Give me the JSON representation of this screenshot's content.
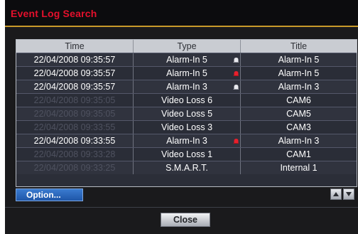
{
  "window": {
    "title": "Event Log Search"
  },
  "table": {
    "headers": {
      "time": "Time",
      "type": "Type",
      "title": "Title"
    },
    "rows": [
      {
        "time": "22/04/2008  09:35:57",
        "type": "Alarm-In 5",
        "title": "Alarm-In 5",
        "icon": "bell-white-icon",
        "dim_time": false
      },
      {
        "time": "22/04/2008  09:35:57",
        "type": "Alarm-In 5",
        "title": "Alarm-In 5",
        "icon": "bell-red-icon",
        "dim_time": false
      },
      {
        "time": "22/04/2008  09:35:57",
        "type": "Alarm-In 3",
        "title": "Alarm-In 3",
        "icon": "bell-white-icon",
        "dim_time": false
      },
      {
        "time": "22/04/2008  09:35:05",
        "type": "Video Loss 6",
        "title": "CAM6",
        "icon": "",
        "dim_time": true
      },
      {
        "time": "22/04/2008  09:35:05",
        "type": "Video Loss 5",
        "title": "CAM5",
        "icon": "",
        "dim_time": true
      },
      {
        "time": "22/04/2008  09:33:55",
        "type": "Video Loss 3",
        "title": "CAM3",
        "icon": "",
        "dim_time": true
      },
      {
        "time": "22/04/2008  09:33:55",
        "type": "Alarm-In 3",
        "title": "Alarm-In 3",
        "icon": "bell-red-icon",
        "dim_time": false
      },
      {
        "time": "22/04/2008  09:33:28",
        "type": "Video Loss 1",
        "title": "CAM1",
        "icon": "",
        "dim_time": true
      },
      {
        "time": "22/04/2008  09:33:25",
        "type": "S.M.A.R.T.",
        "title": "Internal 1",
        "icon": "",
        "dim_time": true
      }
    ]
  },
  "buttons": {
    "option": "Option...",
    "close": "Close",
    "scroll_up_icon": "triangle-up-icon",
    "scroll_down_icon": "triangle-down-icon"
  },
  "colors": {
    "title_red": "#e5102c",
    "accent_gold": "#c89a2a",
    "option_blue": "#1f56a8",
    "bell_red": "#e8202c"
  }
}
